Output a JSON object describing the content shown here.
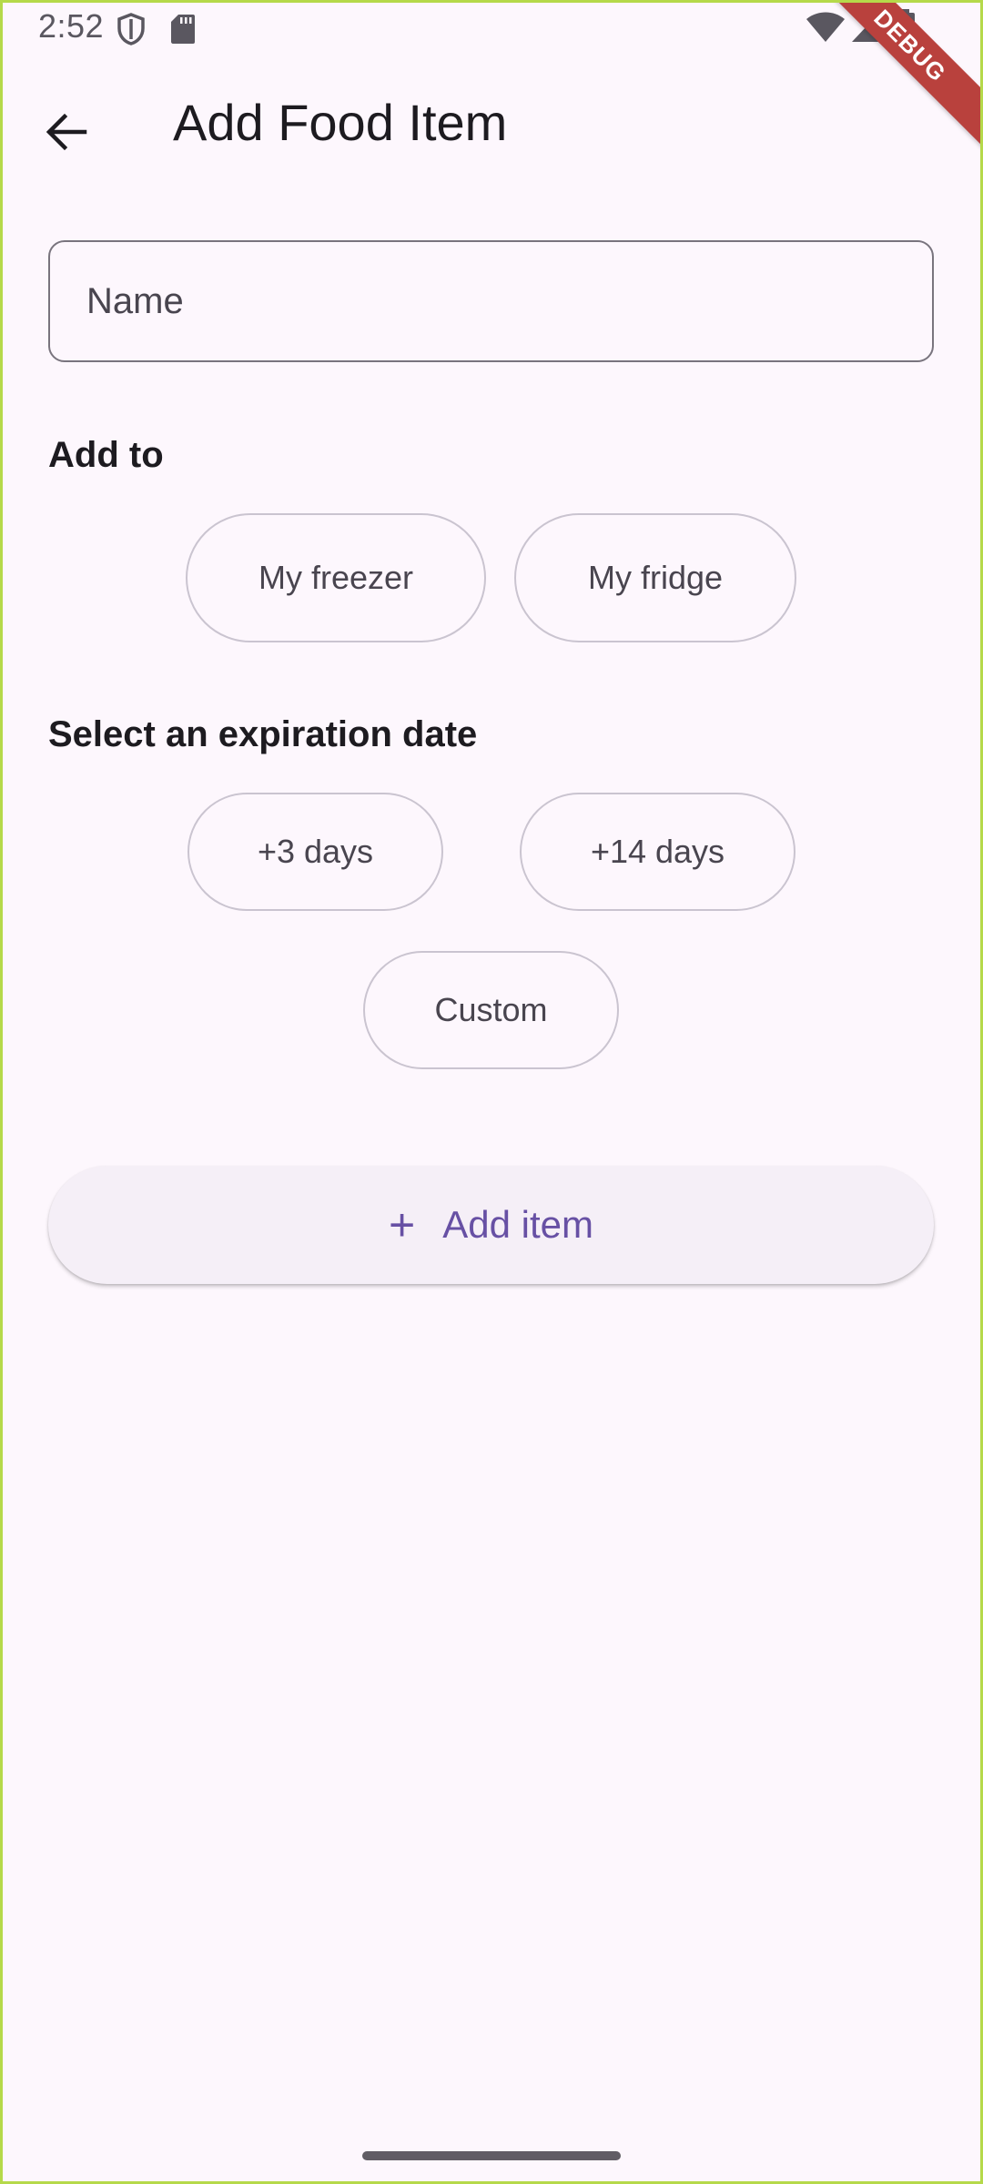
{
  "status_bar": {
    "time": "2:52",
    "left_icons": [
      "shield-icon",
      "sd-card-icon"
    ],
    "right_icons": [
      "wifi-icon",
      "cell-signal-icon",
      "battery-icon"
    ]
  },
  "debug_banner": "DEBUG",
  "app_bar": {
    "back_icon": "arrow-back-icon",
    "title": "Add Food Item"
  },
  "name_input": {
    "placeholder": "Name",
    "value": ""
  },
  "add_to": {
    "label": "Add to",
    "options": [
      "My freezer",
      "My fridge"
    ]
  },
  "expiration": {
    "label": "Select an expiration date",
    "options": [
      "+3 days",
      "+14 days",
      "Custom"
    ]
  },
  "add_button": {
    "icon": "plus-icon",
    "label": "Add item"
  },
  "colors": {
    "background": "#fdf7fd",
    "accent": "#6750a4",
    "outline": "#79747e",
    "chip_outline": "#cac4d0",
    "debug_ribbon": "#b9413d"
  }
}
